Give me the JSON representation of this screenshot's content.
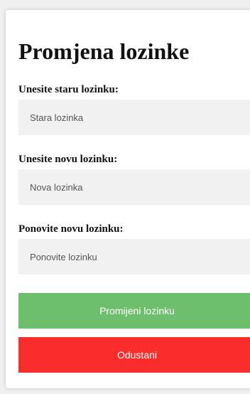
{
  "form": {
    "title": "Promjena lozinke",
    "old_password": {
      "label": "Unesite staru lozinku:",
      "placeholder": "Stara lozinka"
    },
    "new_password": {
      "label": "Unesite novu lozinku:",
      "placeholder": "Nova lozinka"
    },
    "repeat_password": {
      "label": "Ponovite novu lozinku:",
      "placeholder": "Ponovite lozinku"
    },
    "submit_label": "Promijeni lozinku",
    "cancel_label": "Odustani"
  },
  "colors": {
    "submit_button": "#6dbf6d",
    "cancel_button": "#fb2c2c",
    "input_background": "#f1f1f1"
  }
}
